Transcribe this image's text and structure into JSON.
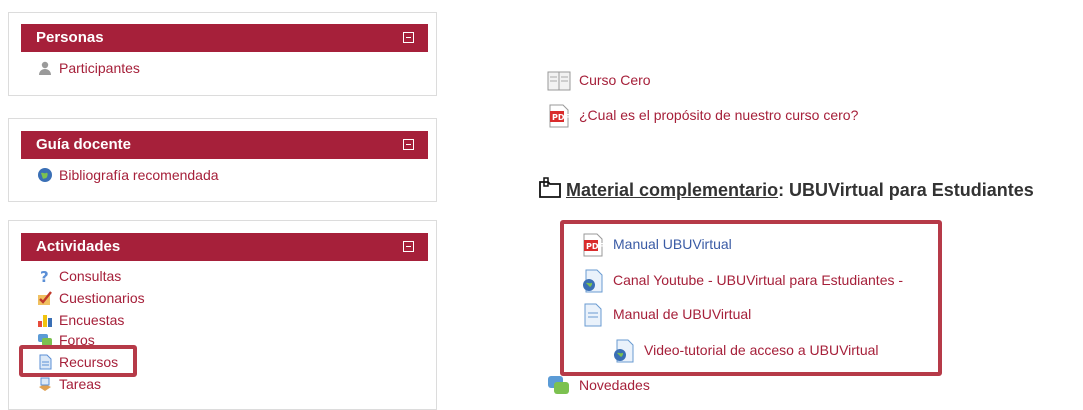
{
  "blocks": {
    "personas": {
      "title": "Personas",
      "items": [
        "Participantes"
      ]
    },
    "guia": {
      "title": "Guía docente",
      "items": [
        "Bibliografía recomendada"
      ]
    },
    "actividades": {
      "title": "Actividades",
      "items": [
        "Consultas",
        "Cuestionarios",
        "Encuestas",
        "Foros",
        "Recursos",
        "Tareas"
      ]
    }
  },
  "main": {
    "resources_top": [
      "Curso Cero",
      "¿Cual es el propósito de nuestro curso cero?"
    ],
    "section": {
      "link": "Material complementario",
      "rest": ": UBUVirtual para Estudiantes"
    },
    "section_resources": [
      "Manual UBUVirtual",
      "Canal Youtube - UBUVirtual para Estudiantes -",
      "Manual de UBUVirtual",
      "Video-tutorial de acceso a UBUVirtual"
    ],
    "forum": "Novedades"
  },
  "colors": {
    "brand": "#a6203a",
    "link": "#3a5ba5",
    "highlight": "#b63a48"
  },
  "icons": [
    "participants-icon",
    "globe-icon",
    "help-icon",
    "quiz-icon",
    "chart-icon",
    "forum-icon",
    "page-icon",
    "assignment-icon",
    "book-icon",
    "pdf-icon",
    "url-icon",
    "folder-icon"
  ]
}
